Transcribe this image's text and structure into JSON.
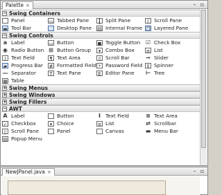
{
  "palette": {
    "tab_label": "Palette",
    "tab_close": "×",
    "categories": [
      {
        "label": "Swing Containers",
        "expanded": true,
        "items": [
          {
            "label": "Panel",
            "icon": "panel-icon"
          },
          {
            "label": "Tabbed Pane",
            "icon": "tabbed-pane-icon"
          },
          {
            "label": "Split Pane",
            "icon": "split-pane-icon"
          },
          {
            "label": "Scroll Pane",
            "icon": "scroll-pane-icon"
          },
          {
            "label": "Tool Bar",
            "icon": "tool-bar-icon"
          },
          {
            "label": "Desktop Pane",
            "icon": "desktop-pane-icon"
          },
          {
            "label": "Internal Frame",
            "icon": "internal-frame-icon"
          },
          {
            "label": "Layered Pane",
            "icon": "layered-pane-icon"
          }
        ]
      },
      {
        "label": "Swing Controls",
        "expanded": true,
        "items": [
          {
            "label": "Label",
            "icon": "label-icon"
          },
          {
            "label": "Button",
            "icon": "button-icon"
          },
          {
            "label": "Toggle Button",
            "icon": "toggle-button-icon"
          },
          {
            "label": "Check Box",
            "icon": "check-box-icon"
          },
          {
            "label": "Radio Button",
            "icon": "radio-button-icon"
          },
          {
            "label": "Button Group",
            "icon": "button-group-icon"
          },
          {
            "label": "Combo Box",
            "icon": "combo-box-icon"
          },
          {
            "label": "List",
            "icon": "list-icon"
          },
          {
            "label": "Text Field",
            "icon": "text-field-icon"
          },
          {
            "label": "Text Area",
            "icon": "text-area-icon"
          },
          {
            "label": "Scroll Bar",
            "icon": "scroll-bar-icon"
          },
          {
            "label": "Slider",
            "icon": "slider-icon"
          },
          {
            "label": "Progress Bar",
            "icon": "progress-bar-icon"
          },
          {
            "label": "Formatted Field",
            "icon": "formatted-field-icon"
          },
          {
            "label": "Password Field",
            "icon": "password-field-icon"
          },
          {
            "label": "Spinner",
            "icon": "spinner-icon"
          },
          {
            "label": "Separator",
            "icon": "separator-icon"
          },
          {
            "label": "Text Pane",
            "icon": "text-pane-icon"
          },
          {
            "label": "Editor Pane",
            "icon": "editor-pane-icon"
          },
          {
            "label": "Tree",
            "icon": "tree-icon"
          },
          {
            "label": "Table",
            "icon": "table-icon"
          }
        ]
      },
      {
        "label": "Swing Menus",
        "expanded": false,
        "items": []
      },
      {
        "label": "Swing Windows",
        "expanded": false,
        "items": []
      },
      {
        "label": "Swing Fillers",
        "expanded": false,
        "items": []
      },
      {
        "label": "AWT",
        "expanded": true,
        "items": [
          {
            "label": "Label",
            "icon": "awt-label-icon"
          },
          {
            "label": "Button",
            "icon": "awt-button-icon"
          },
          {
            "label": "Text Field",
            "icon": "awt-text-field-icon"
          },
          {
            "label": "Text Area",
            "icon": "awt-text-area-icon"
          },
          {
            "label": "Checkbox",
            "icon": "awt-checkbox-icon"
          },
          {
            "label": "Choice",
            "icon": "awt-choice-icon"
          },
          {
            "label": "List",
            "icon": "awt-list-icon"
          },
          {
            "label": "Scrollbar",
            "icon": "awt-scrollbar-icon"
          },
          {
            "label": "Scroll Pane",
            "icon": "awt-scroll-pane-icon"
          },
          {
            "label": "Panel",
            "icon": "awt-panel-icon"
          },
          {
            "label": "Canvas",
            "icon": "awt-canvas-icon"
          },
          {
            "label": "Menu Bar",
            "icon": "awt-menu-bar-icon"
          },
          {
            "label": "Popup Menu",
            "icon": "awt-popup-menu-icon"
          }
        ]
      }
    ]
  },
  "editor": {
    "tab_label": "NewJPanel.java",
    "tab_close": "×"
  }
}
